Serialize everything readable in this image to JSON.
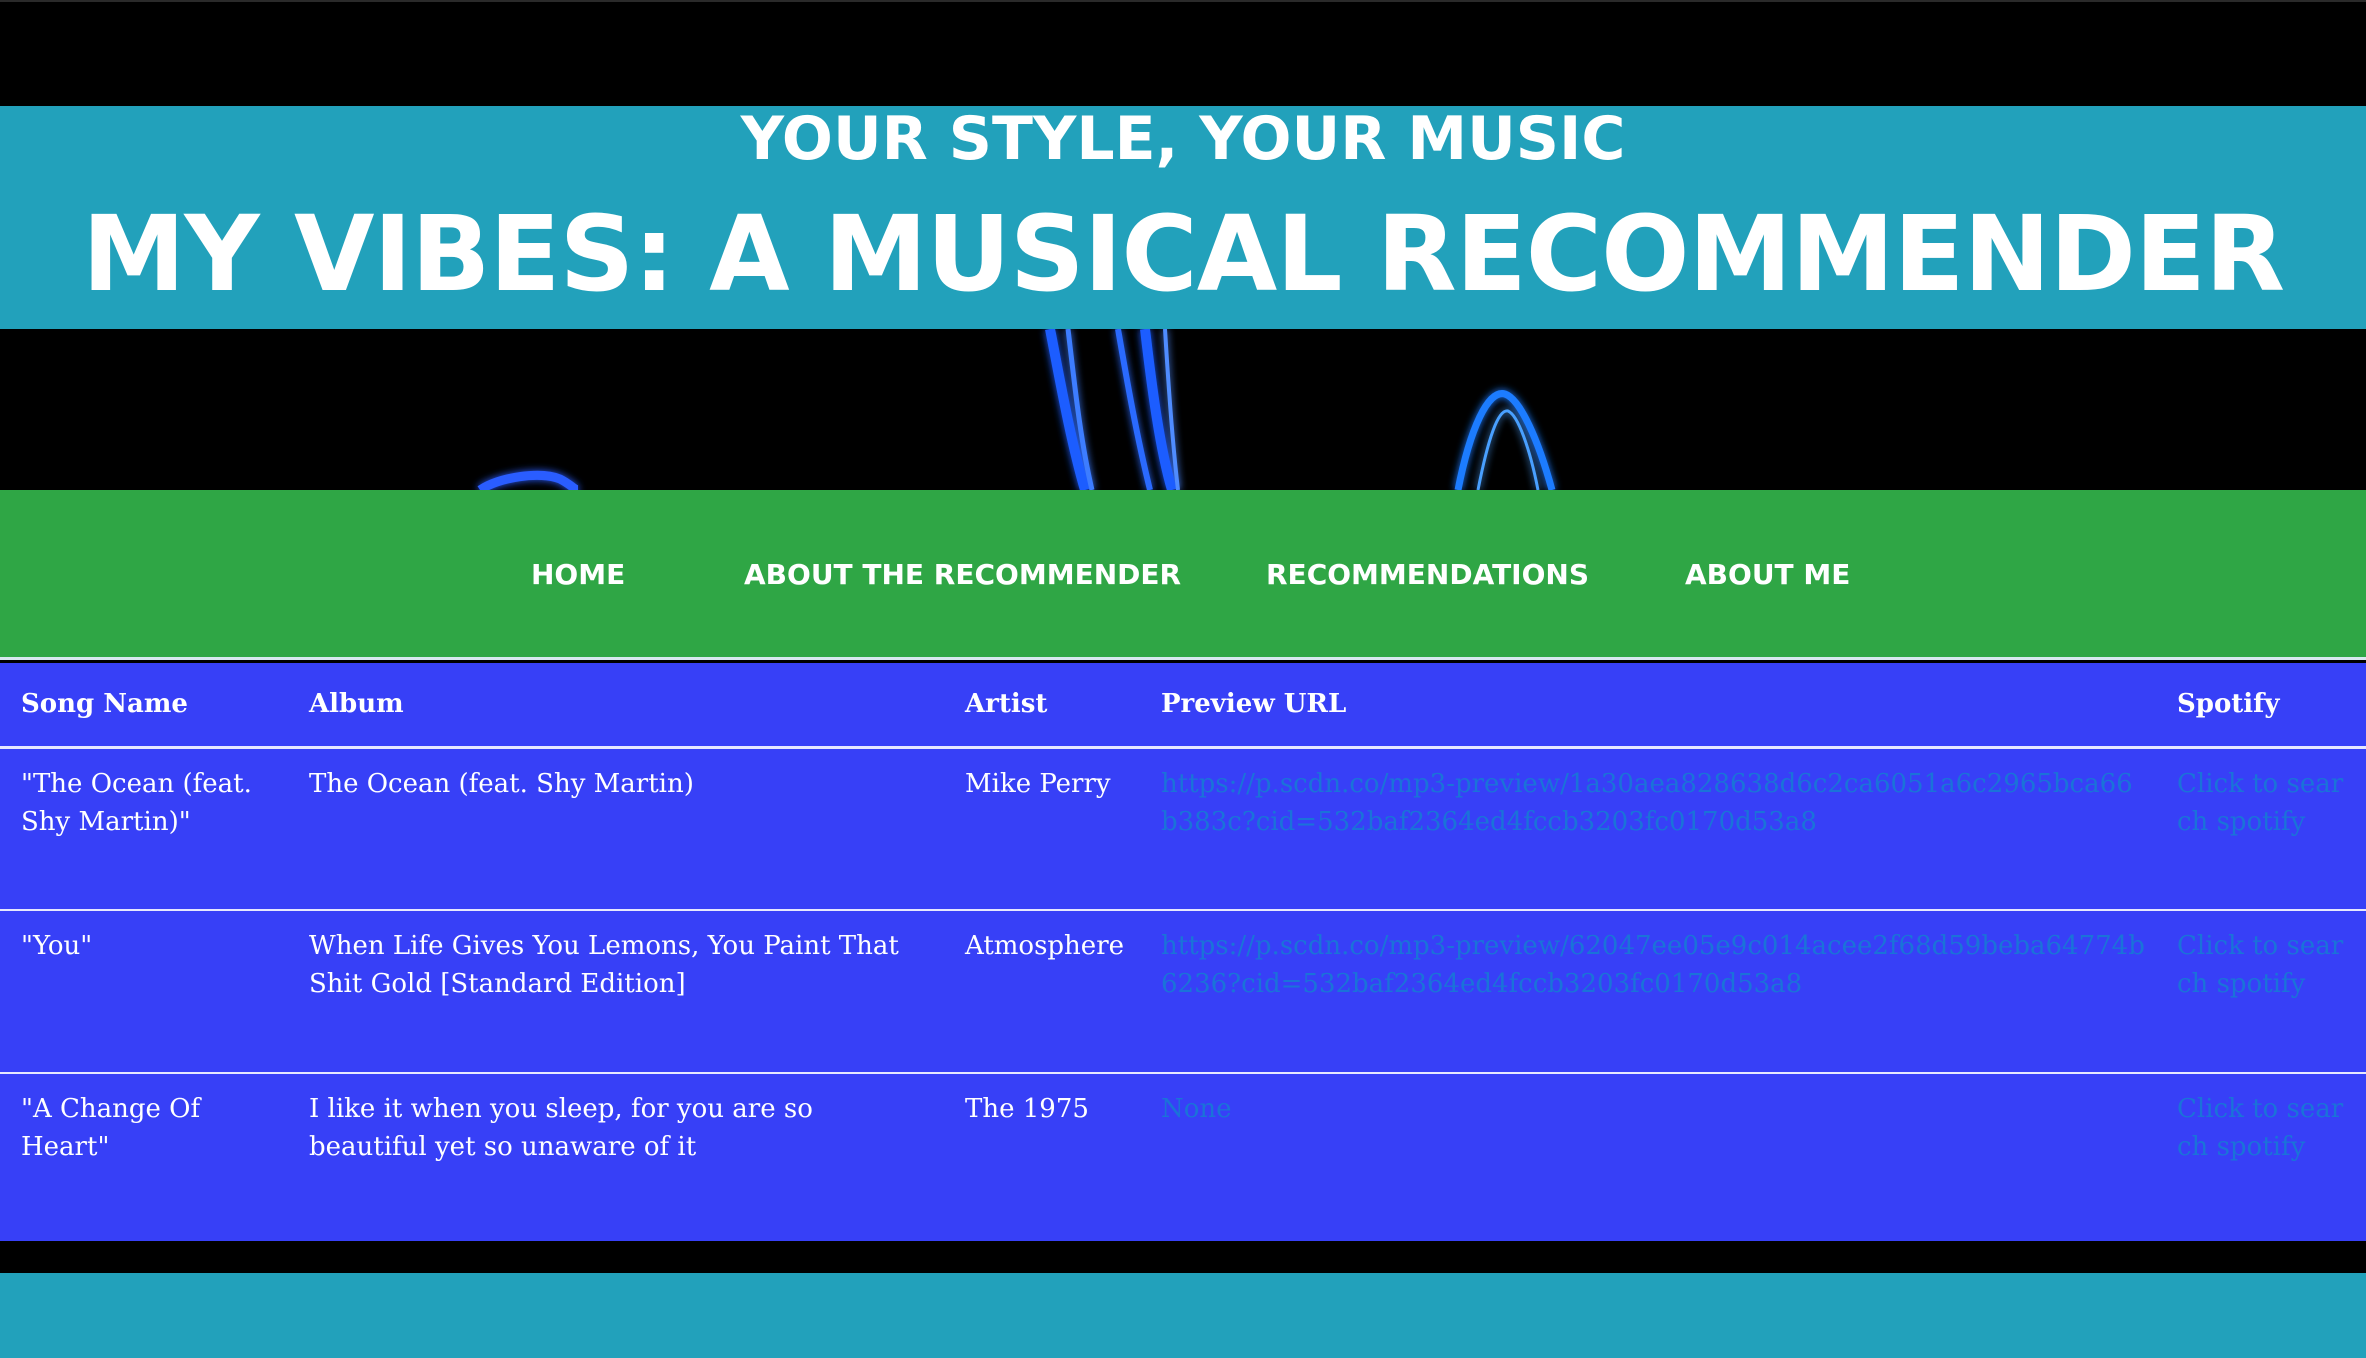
{
  "header": {
    "tagline": "YOUR STYLE, YOUR MUSIC",
    "title": "MY VIBES: A MUSICAL RECOMMENDER"
  },
  "nav": {
    "items": [
      {
        "label": "HOME"
      },
      {
        "label": "ABOUT THE RECOMMENDER"
      },
      {
        "label": "RECOMMENDATIONS"
      },
      {
        "label": "ABOUT ME"
      }
    ]
  },
  "table": {
    "columns": [
      "Song Name",
      "Album",
      "Artist",
      "Preview URL",
      "Spotify"
    ],
    "rows": [
      {
        "song": "\"The Ocean (feat. Shy Martin)\"",
        "album": "The Ocean (feat. Shy Martin)",
        "artist": "Mike Perry",
        "preview_url": "https://p.scdn.co/mp3-preview/1a30aea828638d6c2ca6051a6c2965bca66b383c?cid=532baf2364ed4fccb3203fc0170d53a8",
        "spotify": "Click to search spotify"
      },
      {
        "song": "\"You\"",
        "album": "When Life Gives You Lemons, You Paint That Shit Gold [Standard Edition]",
        "artist": "Atmosphere",
        "preview_url": "https://p.scdn.co/mp3-preview/62047ee05e9c014acee2f68d59beba64774b6236?cid=532baf2364ed4fccb3203fc0170d53a8",
        "spotify": "Click to search spotify"
      },
      {
        "song": "\"A Change Of Heart\"",
        "album": "I like it when you sleep, for you are so beautiful yet so unaware of it",
        "artist": "The 1975",
        "preview_url": "None",
        "spotify": "Click to search spotify"
      }
    ]
  },
  "colors": {
    "header_band": "#22a1bb",
    "nav_bar": "#2fa645",
    "table_bg": "#3740f7",
    "link": "#1a73d9",
    "hero_glow": "#1f5dff"
  }
}
